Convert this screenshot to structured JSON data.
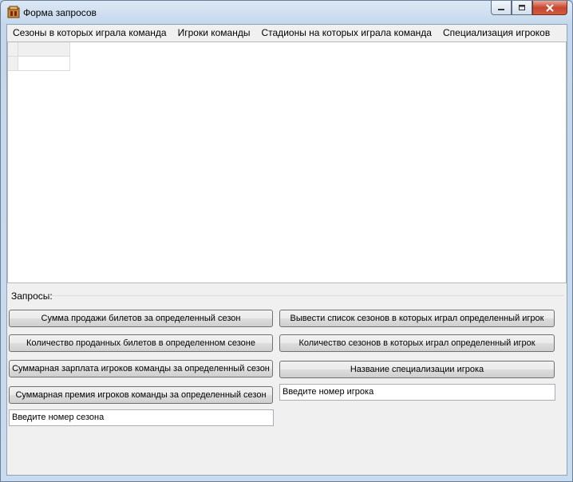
{
  "window": {
    "title": "Форма запросов"
  },
  "tabs": [
    "Сезоны в которых играла команда",
    "Игроки команды",
    "Стадионы на которых играла команда",
    "Специализация игроков"
  ],
  "queries": {
    "group_label": "Запросы:",
    "left_buttons": [
      "Сумма продажи билетов за определенный сезон",
      "Количество проданных билетов в определенном сезоне",
      "Суммарная зарплата игроков команды за определенный сезон",
      "Суммарная премия игроков команды за определенный сезон"
    ],
    "right_buttons": [
      "Вывести список сезонов в которых играл определенный игрок",
      "Количество сезонов в которых играл определенный игрок",
      "Название специализации игрока"
    ],
    "season_input": "Введите номер сезона",
    "player_input": "Введите номер игрока"
  }
}
